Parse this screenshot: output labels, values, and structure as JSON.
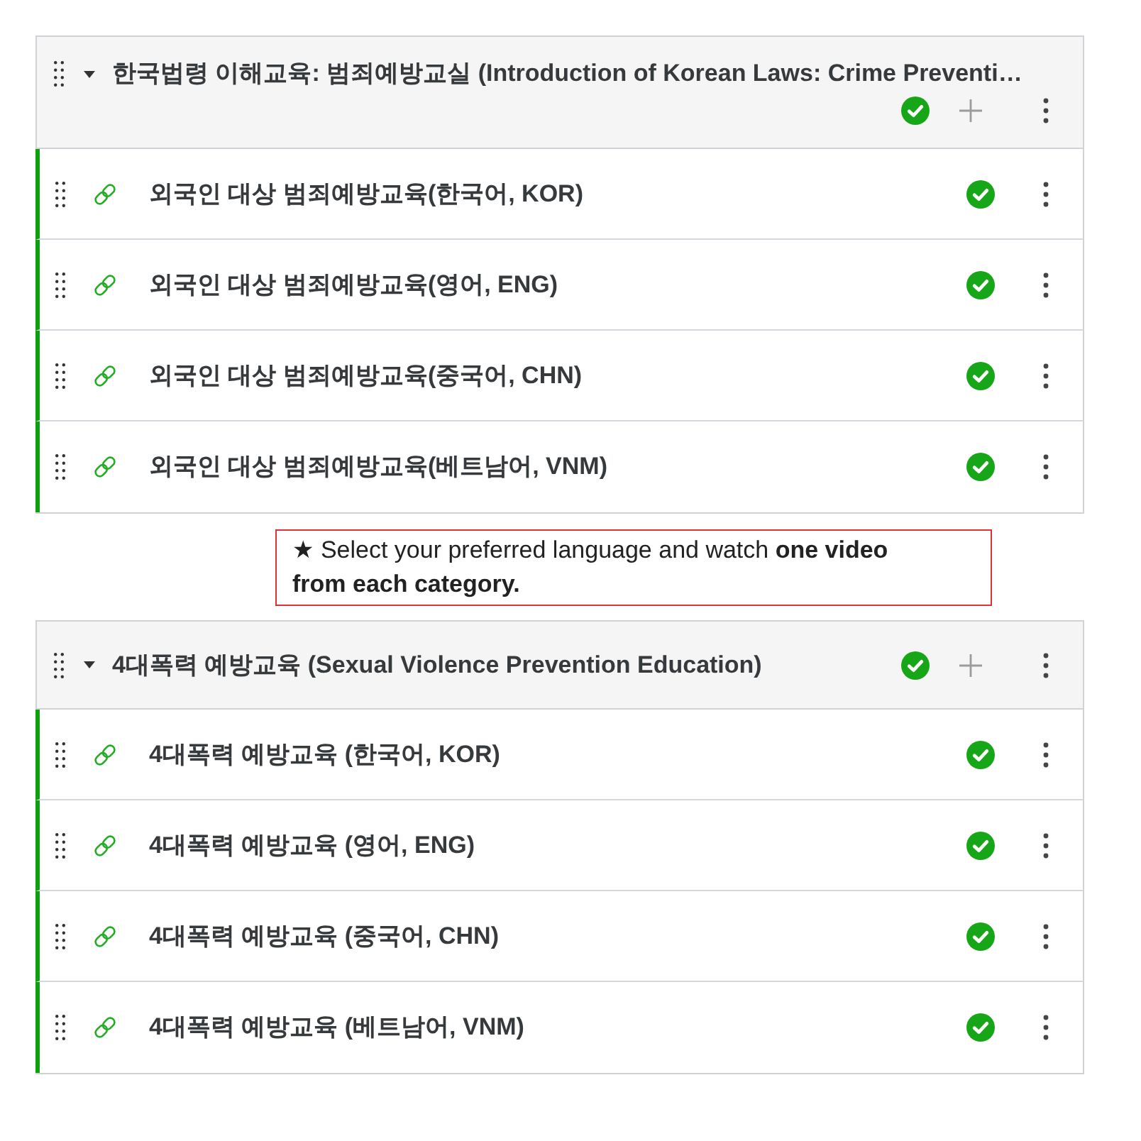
{
  "blocks": [
    {
      "kind": "section",
      "title": "한국법령 이해교육: 범죄예방교실 (Introduction of Korean Laws: Crime Preventi…",
      "expanded": true,
      "completed": true,
      "items": [
        {
          "title": "외국인 대상 범죄예방교육(한국어, KOR)",
          "completed": true
        },
        {
          "title": "외국인 대상 범죄예방교육(영어, ENG)",
          "completed": true
        },
        {
          "title": "외국인 대상 범죄예방교육(중국어, CHN)",
          "completed": true
        },
        {
          "title": "외국인 대상 범죄예방교육(베트남어, VNM)",
          "completed": true
        }
      ]
    },
    {
      "kind": "note",
      "text": "★ Select your preferred language and watch **one video from each category.**"
    },
    {
      "kind": "section",
      "title": "4대폭력 예방교육 (Sexual Violence Prevention Education)",
      "expanded": true,
      "completed": true,
      "items": [
        {
          "title": "4대폭력 예방교육 (한국어, KOR)",
          "completed": true
        },
        {
          "title": "4대폭력 예방교육 (영어, ENG)",
          "completed": true
        },
        {
          "title": "4대폭력 예방교육 (중국어, CHN)",
          "completed": true
        },
        {
          "title": "4대폭력 예방교육 (베트남어, VNM)",
          "completed": true
        }
      ]
    }
  ]
}
